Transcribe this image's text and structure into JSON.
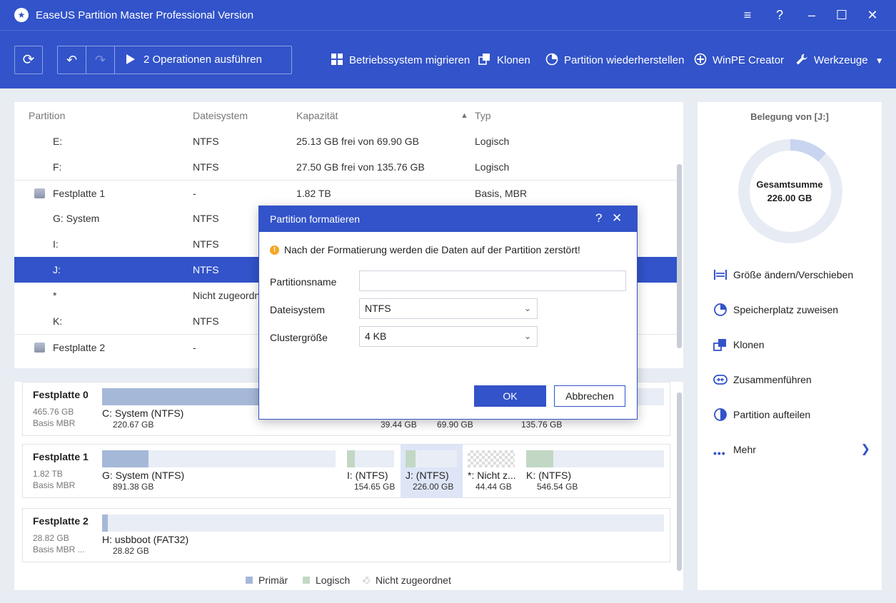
{
  "window": {
    "title": "EaseUS Partition Master Professional Version"
  },
  "toolbar": {
    "run_label": "2 Operationen ausführen",
    "items": [
      "Betriebssystem migrieren",
      "Klonen",
      "Partition wiederherstellen",
      "WinPE Creator",
      "Werkzeuge"
    ]
  },
  "table": {
    "headers": {
      "partition": "Partition",
      "filesystem": "Dateisystem",
      "capacity": "Kapazität",
      "type": "Typ"
    },
    "rows": [
      {
        "name": "E:",
        "fs": "NTFS",
        "cap": "25.13 GB frei von 69.90 GB",
        "type": "Logisch"
      },
      {
        "name": "F:",
        "fs": "NTFS",
        "cap": "27.50 GB frei von 135.76 GB",
        "type": "Logisch"
      },
      {
        "name": "Festplatte 1",
        "fs": "-",
        "cap": "1.82 TB",
        "type": "Basis, MBR"
      },
      {
        "name": "G: System",
        "fs": "NTFS",
        "cap": "",
        "type": ""
      },
      {
        "name": "I:",
        "fs": "NTFS",
        "cap": "",
        "type": ""
      },
      {
        "name": "J:",
        "fs": "NTFS",
        "cap": "",
        "type": ""
      },
      {
        "name": "*",
        "fs": "Nicht zugeordnet",
        "cap": "",
        "type": ""
      },
      {
        "name": "K:",
        "fs": "NTFS",
        "cap": "",
        "type": ""
      },
      {
        "name": "Festplatte 2",
        "fs": "-",
        "cap": "",
        "type": ""
      }
    ]
  },
  "disks": [
    {
      "name": "Festplatte 0",
      "size": "465.76 GB",
      "type": "Basis MBR",
      "partitions": [
        {
          "label": "C: System (NTFS)",
          "size": "220.67 GB"
        },
        {
          "label": "",
          "size": "39.44 GB"
        },
        {
          "label": "",
          "size": "69.90 GB"
        },
        {
          "label": "",
          "size": "135.76 GB"
        }
      ]
    },
    {
      "name": "Festplatte 1",
      "size": "1.82 TB",
      "type": "Basis MBR",
      "partitions": [
        {
          "label": "G: System (NTFS)",
          "size": "891.38 GB"
        },
        {
          "label": "I: (NTFS)",
          "size": "154.65 GB"
        },
        {
          "label": "J: (NTFS)",
          "size": "226.00 GB"
        },
        {
          "label": "*: Nicht z...",
          "size": "44.44 GB"
        },
        {
          "label": "K: (NTFS)",
          "size": "546.54 GB"
        }
      ]
    },
    {
      "name": "Festplatte 2",
      "size": "28.82 GB",
      "type": "Basis MBR ...",
      "partitions": [
        {
          "label": "H: usbboot (FAT32)",
          "size": "28.82 GB"
        }
      ]
    }
  ],
  "legend": {
    "primary": "Primär",
    "logical": "Logisch",
    "unallocated": "Nicht zugeordnet"
  },
  "colors": {
    "accent": "#3253c9",
    "primary_part": "#a6b8d8",
    "logical_part": "#c2d8c4"
  },
  "right_panel": {
    "title": "Belegung von [J:]",
    "total_label": "Gesamtsumme",
    "total_value": "226.00 GB",
    "used_fraction": 0.12,
    "actions": [
      "Größe ändern/Verschieben",
      "Speicherplatz zuweisen",
      "Klonen",
      "Zusammenführen",
      "Partition aufteilen",
      "Mehr"
    ]
  },
  "dialog": {
    "title": "Partition formatieren",
    "warning": "Nach der Formatierung werden die Daten auf der Partition zerstört!",
    "name_label": "Partitionsname",
    "name_value": "",
    "fs_label": "Dateisystem",
    "fs_value": "NTFS",
    "cluster_label": "Clustergröße",
    "cluster_value": "4 KB",
    "ok": "OK",
    "cancel": "Abbrechen"
  }
}
